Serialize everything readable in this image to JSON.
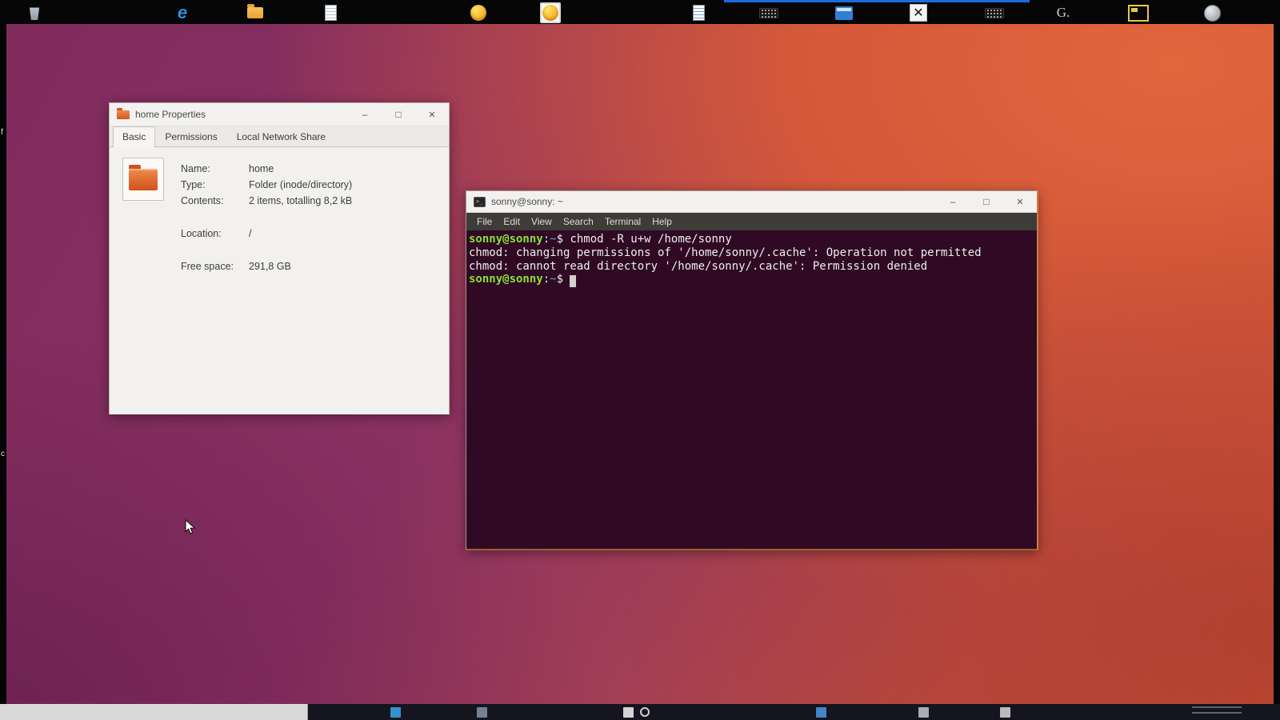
{
  "host": {
    "edge_label_top": "f",
    "edge_label_bottom": "c"
  },
  "properties_window": {
    "title": "home Properties",
    "controls": {
      "minimize": "–",
      "maximize": "□",
      "close": "✕"
    },
    "tabs": [
      {
        "label": "Basic",
        "active": true
      },
      {
        "label": "Permissions",
        "active": false
      },
      {
        "label": "Local Network Share",
        "active": false
      }
    ],
    "fields": [
      {
        "label": "Name:",
        "value": "home"
      },
      {
        "label": "Type:",
        "value": "Folder (inode/directory)"
      },
      {
        "label": "Contents:",
        "value": "2 items, totalling 8,2 kB"
      },
      {
        "label": "Location:",
        "value": "/",
        "gap_before": true
      },
      {
        "label": "Free space:",
        "value": "291,8 GB",
        "gap_before": true
      }
    ]
  },
  "terminal_window": {
    "title": "sonny@sonny: ~",
    "controls": {
      "minimize": "–",
      "maximize": "□",
      "close": "✕"
    },
    "menu": [
      "File",
      "Edit",
      "View",
      "Search",
      "Terminal",
      "Help"
    ],
    "colors": {
      "background": "#300a24",
      "fg": "#eeeeec",
      "user": "#8ae234",
      "path": "#5fa5d6",
      "cursor": "#d3d0cb"
    },
    "lines": [
      {
        "segments": [
          {
            "text": "sonny@sonny",
            "style": "user"
          },
          {
            "text": ":",
            "style": "fg"
          },
          {
            "text": "~",
            "style": "path"
          },
          {
            "text": "$ ",
            "style": "fg"
          },
          {
            "text": "chmod -R u+w /home/sonny",
            "style": "fg"
          }
        ]
      },
      {
        "segments": [
          {
            "text": "chmod: changing permissions of '/home/sonny/.cache': Operation not permitted",
            "style": "fg"
          }
        ]
      },
      {
        "segments": [
          {
            "text": "chmod: cannot read directory '/home/sonny/.cache': Permission denied",
            "style": "fg"
          }
        ]
      },
      {
        "segments": [
          {
            "text": "sonny@sonny",
            "style": "user"
          },
          {
            "text": ":",
            "style": "fg"
          },
          {
            "text": "~",
            "style": "path"
          },
          {
            "text": "$ ",
            "style": "fg"
          },
          {
            "text": " ",
            "style": "cursor"
          }
        ]
      }
    ]
  }
}
